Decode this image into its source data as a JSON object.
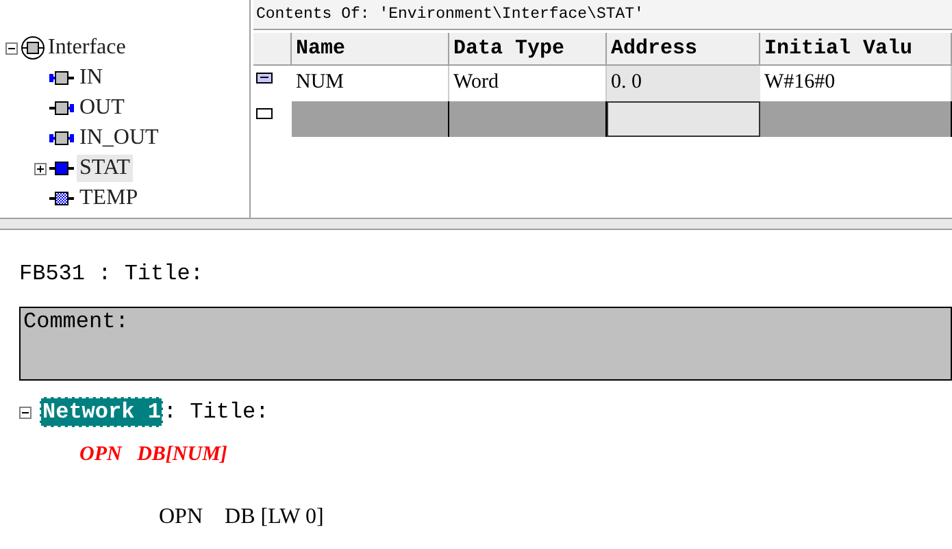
{
  "tree": {
    "label": "Interface",
    "expanded": true,
    "children": [
      {
        "label": "IN",
        "kind": "in",
        "selected": false
      },
      {
        "label": "OUT",
        "kind": "out",
        "selected": false
      },
      {
        "label": "IN_OUT",
        "kind": "inout",
        "selected": false
      },
      {
        "label": "STAT",
        "kind": "stat",
        "selected": true,
        "expanded": false
      },
      {
        "label": "TEMP",
        "kind": "temp",
        "selected": false
      }
    ]
  },
  "contents_title": "Contents Of: 'Environment\\Interface\\STAT'",
  "table": {
    "columns": [
      "Name",
      "Data Type",
      "Address",
      "Initial Valu"
    ],
    "rows": [
      {
        "selected": false,
        "cells": [
          "NUM",
          "Word",
          "0. 0",
          "W#16#0"
        ]
      },
      {
        "selected": true,
        "cells": [
          "",
          "",
          "",
          ""
        ]
      }
    ]
  },
  "block_title": "FB531 : Title:",
  "comment": "Comment:",
  "network": {
    "expanded": true,
    "label": "Network 1",
    "title": ": Title:",
    "lines": [
      {
        "kind": "error",
        "op": "OPN",
        "arg": "DB[NUM]"
      },
      {
        "kind": "normal",
        "op": "OPN",
        "arg": "DB [LW 0]"
      }
    ]
  }
}
